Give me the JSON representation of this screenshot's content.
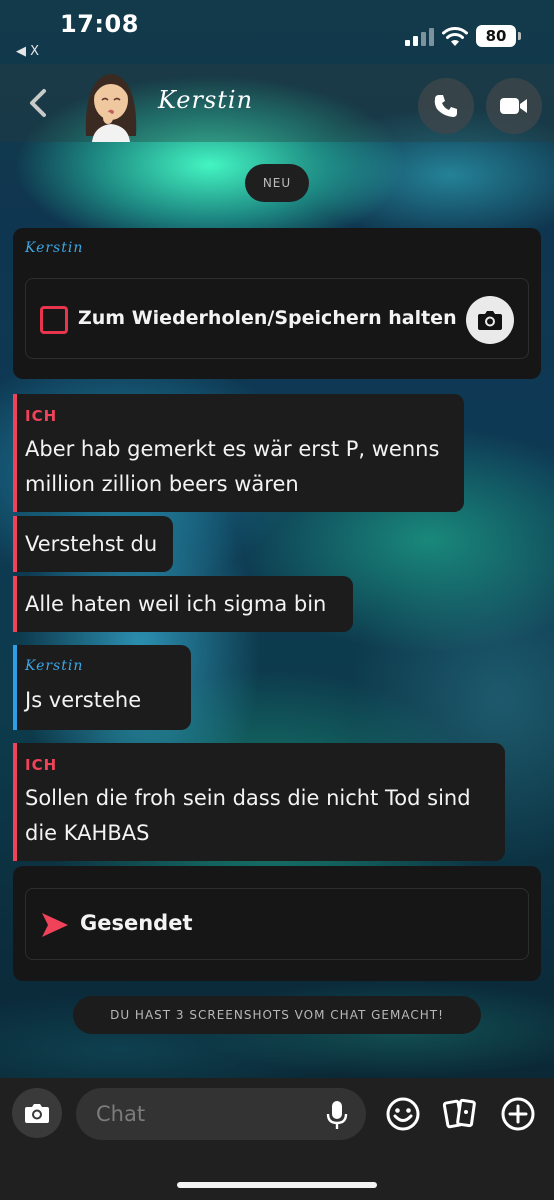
{
  "status": {
    "time": "17:08",
    "back_app": "◀ X",
    "battery": "80"
  },
  "header": {
    "contact_name": "Kerstin",
    "back_icon": "chevron-left-icon",
    "avatar": "bitmoji-avatar",
    "call_icon": "phone-icon",
    "video_icon": "video-camera-icon"
  },
  "chat": {
    "new_divider": "NEU",
    "snap": {
      "sender": "Kerstin",
      "text": "Zum Wiederholen/Speichern halten",
      "camera_icon": "camera-icon"
    },
    "messages": [
      {
        "sender": "ICH",
        "text_lines": [
          "Aber hab gemerkt es wär erst P, wenns",
          "million zillion beers wären"
        ]
      },
      {
        "text_lines": [
          "Verstehst du"
        ]
      },
      {
        "text_lines": [
          "Alle haten weil ich sigma bin"
        ]
      },
      {
        "sender": "Kerstin",
        "text_lines": [
          "Js verstehe"
        ]
      },
      {
        "sender": "ICH",
        "text_lines": [
          "Sollen die froh sein dass die nicht Tod sind",
          "die KAHBAS"
        ]
      }
    ],
    "sent_status": "Gesendet",
    "screenshot_notice": "DU HAST 3 SCREENSHOTS VOM CHAT GEMACHT!"
  },
  "composer": {
    "placeholder": "Chat",
    "camera_icon": "camera-icon",
    "mic_icon": "microphone-icon",
    "emoji_icon": "smiley-icon",
    "cards_icon": "cards-icon",
    "plus_icon": "plus-circle-icon"
  },
  "colors": {
    "me": "#f0435a",
    "friend": "#3aa8e6",
    "card_bg": "#161616"
  }
}
